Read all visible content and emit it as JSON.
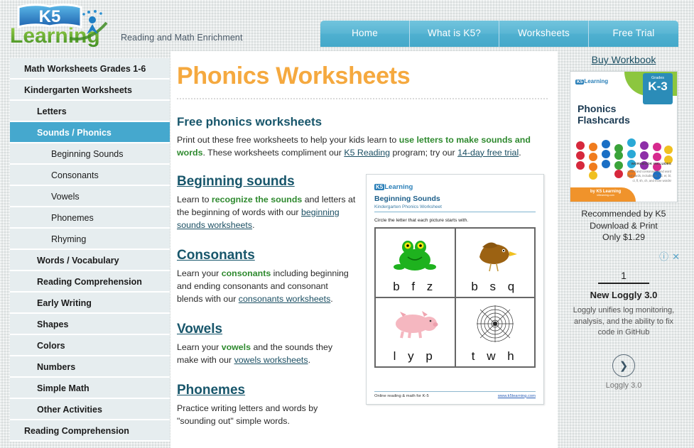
{
  "site": {
    "logo_k5": "K5",
    "logo_word": "Learning",
    "tagline": "Reading and Math Enrichment"
  },
  "nav": {
    "items": [
      {
        "label": "Home"
      },
      {
        "label": "What is K5?"
      },
      {
        "label": "Worksheets"
      },
      {
        "label": "Free Trial"
      }
    ]
  },
  "sidebar": {
    "items": [
      {
        "label": "Math Worksheets Grades 1-6",
        "level": 0,
        "active": false
      },
      {
        "label": "Kindergarten Worksheets",
        "level": 0,
        "active": false
      },
      {
        "label": "Letters",
        "level": 1,
        "active": false
      },
      {
        "label": "Sounds / Phonics",
        "level": 1,
        "active": true
      },
      {
        "label": "Beginning Sounds",
        "level": 2,
        "active": false
      },
      {
        "label": "Consonants",
        "level": 2,
        "active": false
      },
      {
        "label": "Vowels",
        "level": 2,
        "active": false
      },
      {
        "label": "Phonemes",
        "level": 2,
        "active": false
      },
      {
        "label": "Rhyming",
        "level": 2,
        "active": false
      },
      {
        "label": "Words / Vocabulary",
        "level": 1,
        "active": false
      },
      {
        "label": "Reading Comprehension",
        "level": 1,
        "active": false
      },
      {
        "label": "Early Writing",
        "level": 1,
        "active": false
      },
      {
        "label": "Shapes",
        "level": 1,
        "active": false
      },
      {
        "label": "Colors",
        "level": 1,
        "active": false
      },
      {
        "label": "Numbers",
        "level": 1,
        "active": false
      },
      {
        "label": "Simple Math",
        "level": 1,
        "active": false
      },
      {
        "label": "Other Activities",
        "level": 1,
        "active": false
      },
      {
        "label": "Reading Comprehension",
        "level": 0,
        "active": false
      }
    ]
  },
  "main": {
    "page_title": "Phonics Worksheets",
    "intro_heading": "Free phonics worksheets",
    "intro": {
      "line1_a": "Print out these free worksheets to help your kids learn to ",
      "line1_highlight": "use letters to make sounds and words",
      "line1_b": ".",
      "line2_a": "These worksheets compliment our ",
      "line2_link1": "K5 Reading",
      "line2_b": " program; try our ",
      "line2_link2": "14-day free trial",
      "line2_c": "."
    },
    "sections": [
      {
        "heading": "Beginning sounds",
        "text_a": "Learn to ",
        "highlight": "recognize the sounds",
        "text_b": " and letters at the beginning of words with our ",
        "link": "beginning sounds worksheets",
        "text_c": "."
      },
      {
        "heading": "Consonants",
        "text_a": "Learn your ",
        "highlight": "consonants",
        "text_b": " including beginning and ending consonants and consonant blends with our ",
        "link": "consonants worksheets",
        "text_c": "."
      },
      {
        "heading": "Vowels",
        "text_a": "Learn your ",
        "highlight": "vowels",
        "text_b": " and the sounds they make with our ",
        "link": "vowels worksheets",
        "text_c": "."
      },
      {
        "heading": "Phonemes",
        "text_a": "Practice writing letters and words by \"sounding out\" simple words.",
        "highlight": "",
        "text_b": "",
        "link": "",
        "text_c": ""
      }
    ]
  },
  "worksheet": {
    "logo_k5": "K5",
    "logo_word": "Learning",
    "title": "Beginning Sounds",
    "subtitle": "Kindergarten Phonics Worksheet",
    "instruction": "Circle the letter that each picture starts with.",
    "cells": [
      {
        "picture": "frog-illustration",
        "letters": "b f z"
      },
      {
        "picture": "bird-illustration",
        "letters": "b s q"
      },
      {
        "picture": "pig-illustration",
        "letters": "l y p"
      },
      {
        "picture": "spiderweb-illustration",
        "letters": "t w h"
      }
    ],
    "footer_left": "Online reading & math for K-5",
    "footer_right": "www.k5learning.com"
  },
  "rail": {
    "buy_link": "Buy Workbook",
    "cover": {
      "logo_k5": "K5",
      "logo_word": "Learning",
      "grades_label": "Grades",
      "grades_value": "K-3",
      "title_line1": "Phonics",
      "title_line2": "Flashcards",
      "includes_heading": "WORKBOOK INCLUDES",
      "includes_text": "Vowel and consonant blend word flashcards, including br, ed, er, bl, cl, fl, sh, ch, and more words!",
      "footer_brand": "by K5 Learning",
      "footer_sub": "k5learning.com"
    },
    "recommend_line1": "Recommended by K5",
    "recommend_line2": "Download & Print",
    "recommend_line3": "Only $1.29",
    "ad": {
      "info_icon": "info-icon",
      "close_icon": "close-icon",
      "number": "1",
      "headline": "New Loggly 3.0",
      "body": "Loggly unifies log monitoring, analysis, and the ability to fix code in GitHub",
      "arrow_icon": "chevron-right-icon",
      "caption": "Loggly 3.0"
    }
  },
  "colors": {
    "nav_blue": "#4fb0d0",
    "active_sidebar": "#45a8ce",
    "title_orange": "#f5a93f",
    "heading_teal": "#18566b",
    "highlight_green": "#2f8a2f",
    "page_bg": "#e7eaea"
  },
  "dot_colors": [
    "#d6283c",
    "#f07c1e",
    "#1b6fc4",
    "#3aa33a",
    "#2aa9d6",
    "#8e2fa8",
    "#d62a8e",
    "#f0c020"
  ]
}
